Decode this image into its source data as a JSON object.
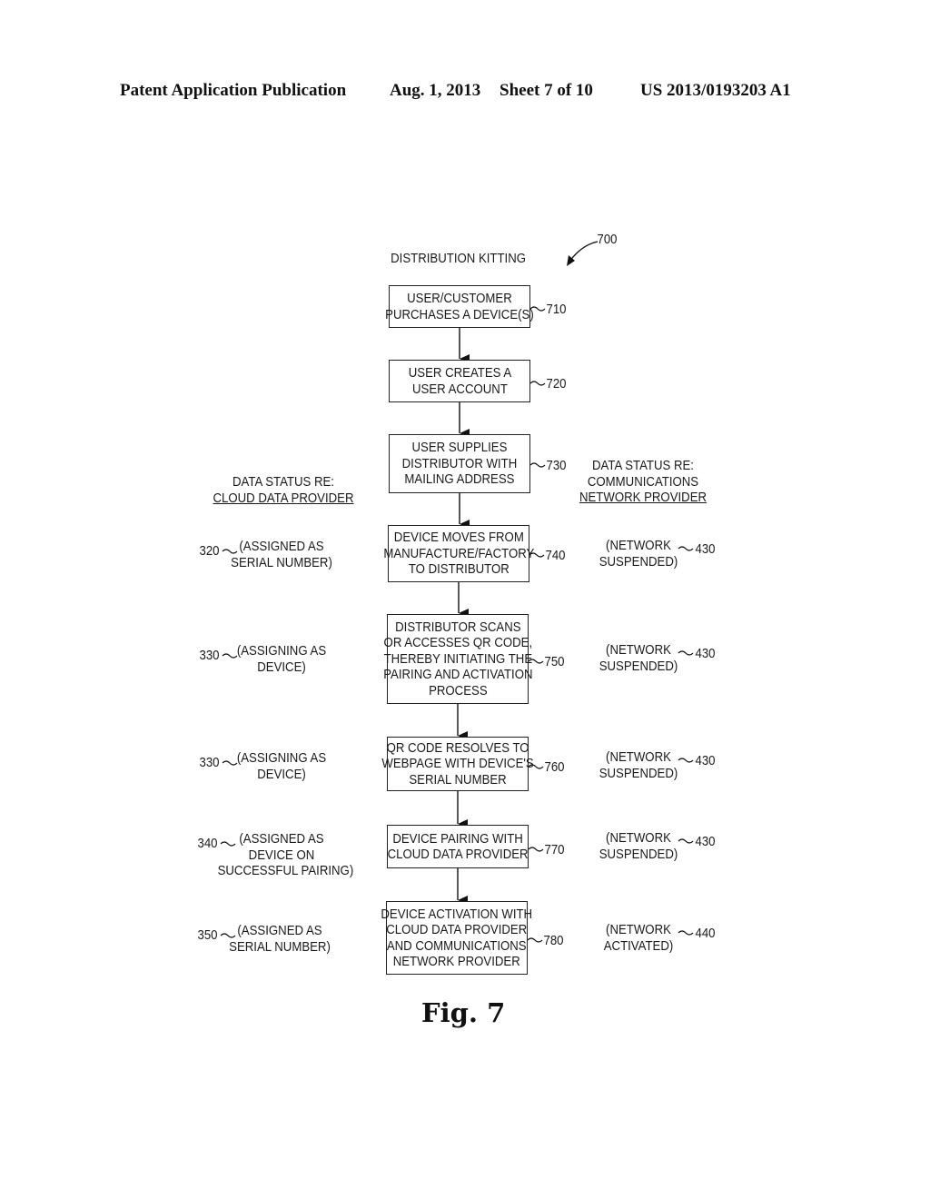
{
  "header": {
    "left": "Patent Application Publication",
    "date": "Aug. 1, 2013",
    "sheet": "Sheet 7 of 10",
    "number": "US 2013/0193203 A1"
  },
  "diagram": {
    "ref": "700",
    "title": "DISTRIBUTION KITTING",
    "left_heading": {
      "line1": "DATA STATUS RE:",
      "line2": "CLOUD DATA PROVIDER"
    },
    "right_heading": {
      "line1": "DATA STATUS RE:",
      "line2": "COMMUNICATIONS",
      "line3": "NETWORK PROVIDER"
    },
    "steps": [
      {
        "ref": "710",
        "lines": [
          "USER/CUSTOMER",
          "PURCHASES A DEVICE(S)"
        ]
      },
      {
        "ref": "720",
        "lines": [
          "USER CREATES A",
          "USER ACCOUNT"
        ]
      },
      {
        "ref": "730",
        "lines": [
          "USER SUPPLIES",
          "DISTRIBUTOR WITH",
          "MAILING ADDRESS"
        ]
      },
      {
        "ref": "740",
        "lines": [
          "DEVICE MOVES FROM",
          "MANUFACTURE/FACTORY",
          "TO DISTRIBUTOR"
        ]
      },
      {
        "ref": "750",
        "lines": [
          "DISTRIBUTOR SCANS",
          "OR ACCESSES QR CODE,",
          "THEREBY INITIATING THE",
          "PAIRING AND ACTIVATION",
          "PROCESS"
        ]
      },
      {
        "ref": "760",
        "lines": [
          "QR CODE RESOLVES TO",
          "WEBPAGE WITH DEVICE'S",
          "SERIAL NUMBER"
        ]
      },
      {
        "ref": "770",
        "lines": [
          "DEVICE PAIRING WITH",
          "CLOUD DATA PROVIDER"
        ]
      },
      {
        "ref": "780",
        "lines": [
          "DEVICE ACTIVATION WITH",
          "CLOUD DATA PROVIDER",
          "AND COMMUNICATIONS",
          "NETWORK PROVIDER"
        ]
      }
    ],
    "cloud_status": [
      {
        "ref": "320",
        "lines": [
          "(ASSIGNED AS",
          "SERIAL NUMBER)"
        ]
      },
      {
        "ref": "330",
        "lines": [
          "(ASSIGNING AS",
          "DEVICE)"
        ]
      },
      {
        "ref": "330",
        "lines": [
          "(ASSIGNING AS",
          "DEVICE)"
        ]
      },
      {
        "ref": "340",
        "lines": [
          "(ASSIGNED AS",
          "DEVICE ON",
          "SUCCESSFUL PAIRING)"
        ]
      },
      {
        "ref": "350",
        "lines": [
          "(ASSIGNED AS",
          "SERIAL NUMBER)"
        ]
      }
    ],
    "network_status": [
      {
        "ref": "430",
        "lines": [
          "(NETWORK",
          "SUSPENDED)"
        ]
      },
      {
        "ref": "430",
        "lines": [
          "(NETWORK",
          "SUSPENDED)"
        ]
      },
      {
        "ref": "430",
        "lines": [
          "(NETWORK",
          "SUSPENDED)"
        ]
      },
      {
        "ref": "430",
        "lines": [
          "(NETWORK",
          "SUSPENDED)"
        ]
      },
      {
        "ref": "440",
        "lines": [
          "(NETWORK",
          "ACTIVATED)"
        ]
      }
    ],
    "figure_label": "Fig. 7"
  }
}
